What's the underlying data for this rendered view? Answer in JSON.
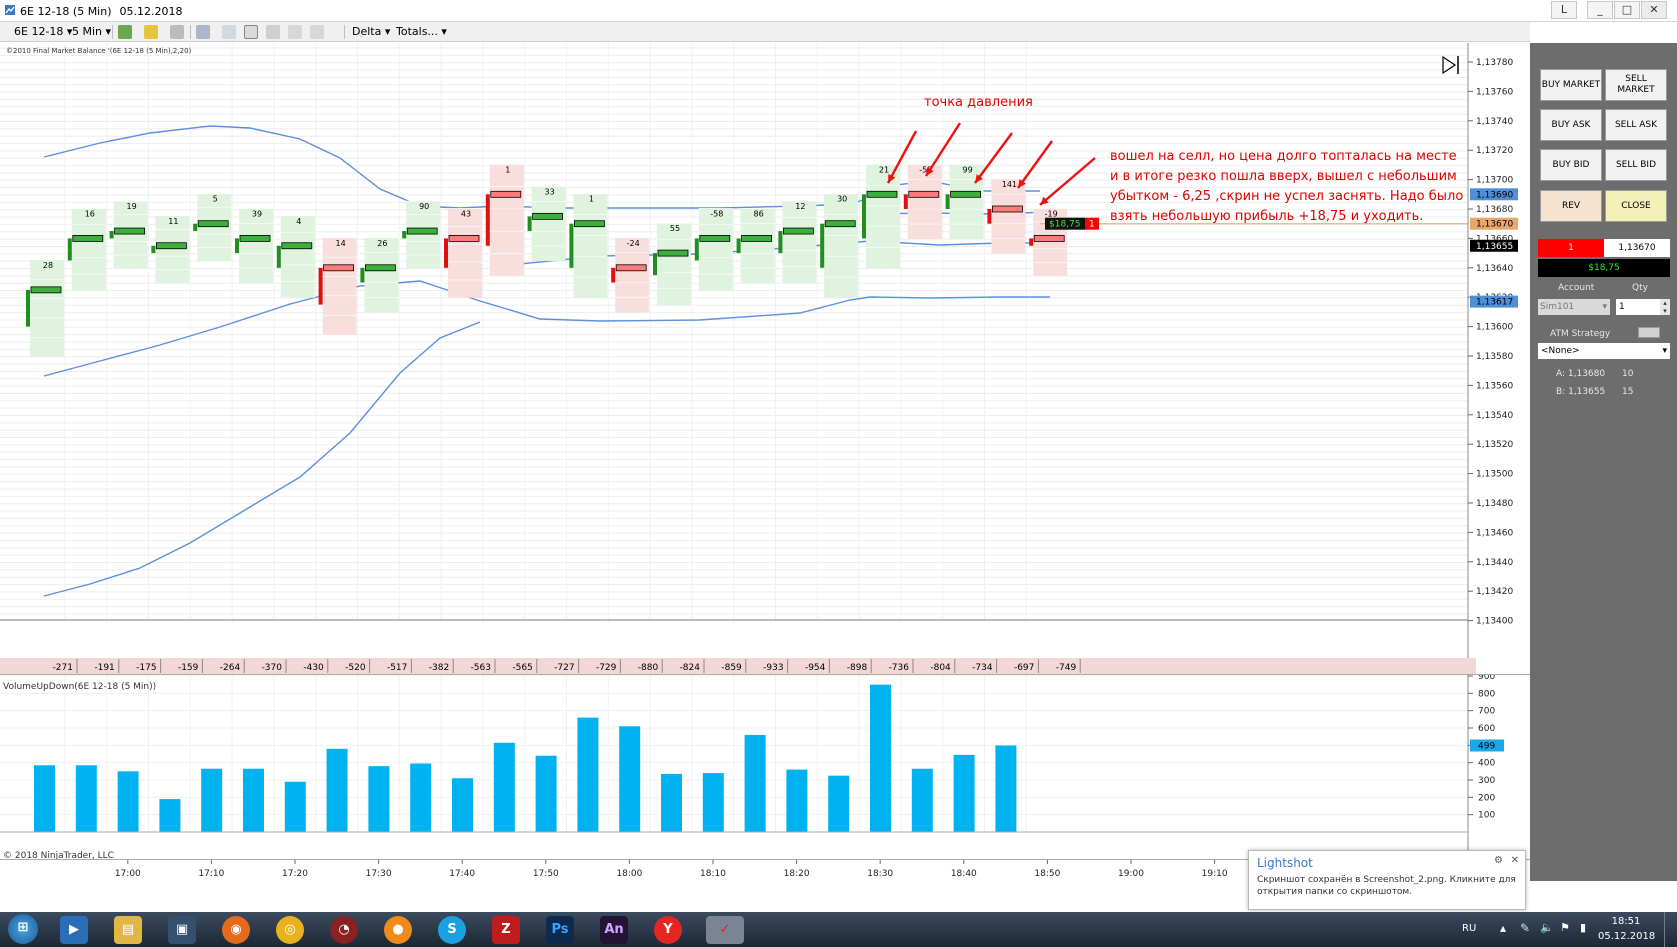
{
  "window": {
    "title_instrument": "6E 12-18 (5 Min)",
    "title_date": "05.12.2018",
    "buttons": [
      "L",
      "_",
      "□",
      "✕"
    ]
  },
  "toolbar": {
    "instrument": "6E 12-18",
    "interval": "5 Min",
    "delta_label": "Delta",
    "totals_label": "Totals..."
  },
  "chart": {
    "indicator_label": "©2010 Final Market Balance '(6E 12-18 (5 Min),2,20)",
    "copyright": "© 2018 NinjaTrader, LLC",
    "volume_label": "VolumeUpDown(6E 12-18 (5 Min))",
    "price_ticks": [
      "1,13780",
      "1,13760",
      "1,13740",
      "1,13720",
      "1,13700",
      "1,13680",
      "1,13660",
      "1,13640",
      "1,13620",
      "1,13600",
      "1,13580",
      "1,13560",
      "1,13540",
      "1,13520",
      "1,13500",
      "1,13480",
      "1,13460",
      "1,13440",
      "1,13420",
      "1,13400"
    ],
    "price_markers": [
      {
        "text": "1,13690",
        "color": "#4f8fd8",
        "price": 1.1369
      },
      {
        "text": "1,13670",
        "color": "#e8a66a",
        "price": 1.1367
      },
      {
        "text": "1,13655",
        "color": "#000000",
        "price": 1.13655
      },
      {
        "text": "1,13617",
        "color": "#4f8fd8",
        "price": 1.13617
      }
    ],
    "position_label": "$18,75",
    "position_qty": "1",
    "volume_ticks": [
      "900",
      "800",
      "700",
      "600",
      "500",
      "400",
      "300",
      "200",
      "100"
    ],
    "volume_marker": "499",
    "time_ticks": [
      "17:00",
      "17:10",
      "17:20",
      "17:30",
      "17:40",
      "17:50",
      "18:00",
      "18:10",
      "18:20",
      "18:30",
      "18:40",
      "18:50",
      "19:00",
      "19:10"
    ]
  },
  "chart_data": {
    "type": "bar",
    "categories": [
      "16:55",
      "17:00",
      "17:05",
      "17:10",
      "17:15",
      "17:20",
      "17:25",
      "17:30",
      "17:35",
      "17:40",
      "17:45",
      "17:50",
      "17:55",
      "18:00",
      "18:05",
      "18:10",
      "18:15",
      "18:20",
      "18:25",
      "18:30",
      "18:35",
      "18:40",
      "18:45",
      "18:50"
    ],
    "series": [
      {
        "name": "VolumeUpDown(6E 12-18 (5 Min))",
        "values": [
          385,
          385,
          350,
          190,
          365,
          365,
          290,
          480,
          380,
          395,
          310,
          515,
          440,
          660,
          610,
          335,
          340,
          560,
          360,
          325,
          850,
          365,
          445,
          499
        ]
      }
    ],
    "cumulative_delta": [
      -271,
      -191,
      -175,
      -159,
      -264,
      -370,
      -430,
      -520,
      -517,
      -382,
      -563,
      -565,
      -727,
      -729,
      -880,
      -824,
      -859,
      -933,
      -954,
      -898,
      -736,
      -804,
      -734,
      -697,
      -749
    ],
    "ylim": [
      0,
      900
    ]
  },
  "annotations": {
    "pressure_point": "точка давления",
    "note_lines": [
      "вошел на селл, но цена долго топталась на месте",
      "и в итоге резко пошла вверх, вышел с небольшим",
      "убытком - 6,25 ,скрин не успел заснять. Надо было",
      "взять небольшую прибыль +18,75 и уходить."
    ]
  },
  "side_panel": {
    "buy_market": "BUY MARKET",
    "sell_market": "SELL MARKET",
    "buy_ask": "BUY ASK",
    "sell_ask": "SELL ASK",
    "buy_bid": "BUY BID",
    "sell_bid": "SELL BID",
    "rev": "REV",
    "close": "CLOSE",
    "position_qty": "1",
    "position_price": "1,13670",
    "pnl": "$18,75",
    "account_label": "Account",
    "qty_label": "Qty",
    "account_value": "Sim101",
    "qty_value": "1",
    "atm_label": "ATM Strategy",
    "atm_value": "<None>",
    "ask_label": "A: 1,13680",
    "ask_qty": "10",
    "bid_label": "B: 1,13655",
    "bid_qty": "15"
  },
  "lightshot": {
    "title": "Lightshot",
    "message": "Скриншот сохранён в Screenshot_2.png. Кликните для открытия папки со скриншотом."
  },
  "taskbar": {
    "lang": "RU",
    "time": "18:51",
    "date": "05.12.2018"
  }
}
